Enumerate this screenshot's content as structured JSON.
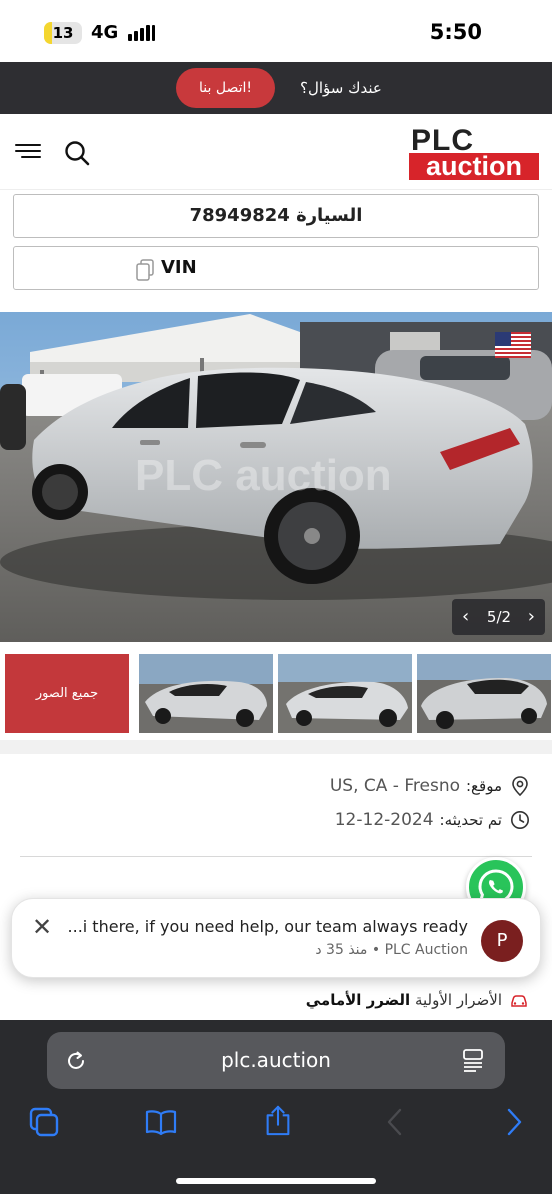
{
  "status": {
    "battery": "13",
    "network": "4G",
    "time": "5:50"
  },
  "banner": {
    "question": "عندك سؤال؟",
    "contact_button": "اتصل بنا!"
  },
  "header": {
    "logo_top": "PLC",
    "logo_bottom": "auction",
    "menu_icon": "hamburger-icon",
    "search_icon": "search-icon"
  },
  "lot": {
    "car_label": "السيارة 78949824",
    "vin_label": "VIN"
  },
  "gallery": {
    "counter": "5/2",
    "prev": "‹",
    "next": "›",
    "all_photos": "جميع الصور",
    "watermark": "PLC auction",
    "flag": "us-flag-icon"
  },
  "details": {
    "location_label": "موقع:",
    "location_value": "US, CA - Fresno",
    "updated_label": "تم تحديثه:",
    "updated_value": "12-12-2024"
  },
  "damage": {
    "label": "الأضرار الأولية",
    "value": "الضرر الأمامي"
  },
  "notification": {
    "message": "...i there, if you need help, our team always ready",
    "meta": "PLC Auction • منذ 35 د",
    "avatar": "P",
    "close": "✕"
  },
  "browser": {
    "url": "plc.auction"
  },
  "colors": {
    "brand_red": "#d7242a",
    "banner_bg": "#2e2e32",
    "whatsapp": "#29c45a",
    "ios_blue": "#2f7cf6"
  }
}
